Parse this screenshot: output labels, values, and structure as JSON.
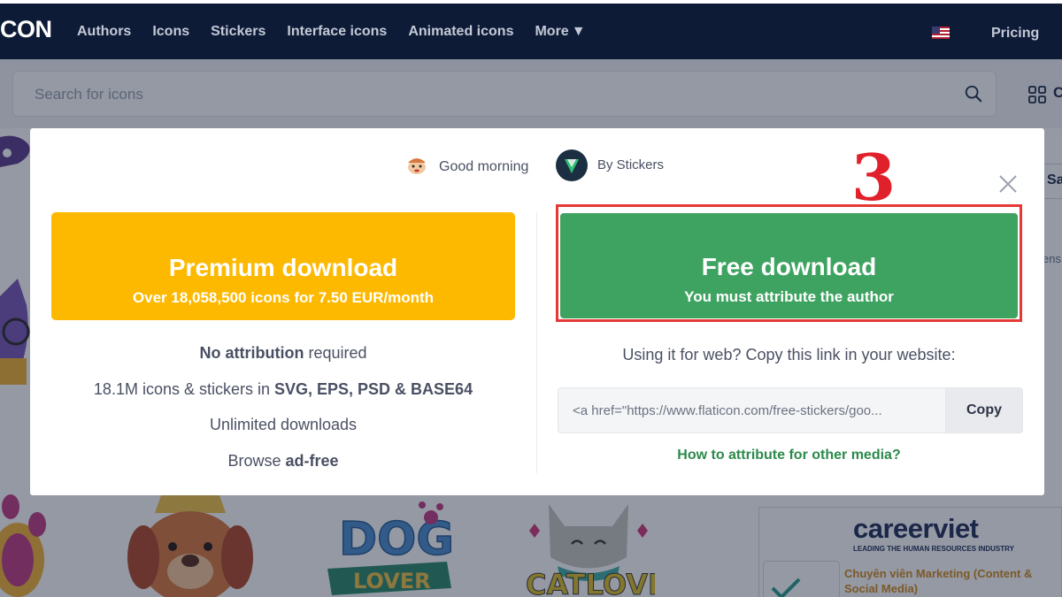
{
  "nav": {
    "logo": "CON",
    "links": [
      "Authors",
      "Icons",
      "Stickers",
      "Interface icons",
      "Animated icons",
      "More"
    ],
    "pricing": "Pricing"
  },
  "search": {
    "placeholder": "Search for icons"
  },
  "bg": {
    "grid_letter": "C",
    "side_tab": "Sa",
    "side_text": "ens",
    "ad": {
      "logo": "careerviet",
      "tagline": "LEADING THE HUMAN RESOURCES INDUSTRY",
      "title": "Chuyên viên Marketing (Content & Social Media)"
    }
  },
  "modal": {
    "greeting": "Good morning",
    "author": "By Stickers",
    "step_number": "3",
    "premium": {
      "title": "Premium download",
      "subtitle": "Over 18,058,500 icons for 7.50 EUR/month"
    },
    "features": [
      {
        "bold": "No attribution",
        "text": " required"
      },
      {
        "text": "18.1M icons & stickers in ",
        "bold": "SVG, EPS, PSD & BASE64"
      },
      {
        "text": "Unlimited downloads"
      },
      {
        "text": "Browse ",
        "bold": "ad-free"
      }
    ],
    "free": {
      "title": "Free download",
      "subtitle": "You must attribute the author"
    },
    "web_label": "Using it for web? Copy this link in your website:",
    "link_value": "<a href=\"https://www.flaticon.com/free-stickers/goo...",
    "copy_label": "Copy",
    "attribution_link": "How to attribute for other media?"
  },
  "colors": {
    "nav_bg": "#0e1b37",
    "premium": "#fdb900",
    "free": "#3ea360",
    "highlight": "#e53935",
    "link_green": "#2b8a4b"
  }
}
